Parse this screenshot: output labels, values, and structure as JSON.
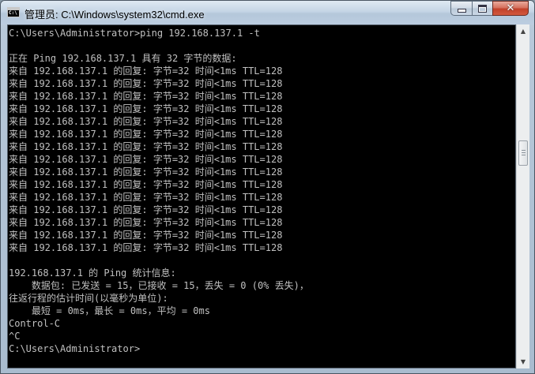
{
  "window": {
    "title": "管理员: C:\\Windows\\system32\\cmd.exe",
    "app_icon_text": "C:\\"
  },
  "controls": {
    "minimize_icon": "minimize-icon",
    "maximize_icon": "maximize-icon",
    "close_icon": "close-icon",
    "close_glyph": "✕"
  },
  "console": {
    "colors": {
      "background": "#000000",
      "text": "#C0C0C0"
    },
    "lines": [
      "C:\\Users\\Administrator>ping 192.168.137.1 -t",
      "",
      "正在 Ping 192.168.137.1 具有 32 字节的数据:",
      "来自 192.168.137.1 的回复: 字节=32 时间<1ms TTL=128",
      "来自 192.168.137.1 的回复: 字节=32 时间<1ms TTL=128",
      "来自 192.168.137.1 的回复: 字节=32 时间<1ms TTL=128",
      "来自 192.168.137.1 的回复: 字节=32 时间<1ms TTL=128",
      "来自 192.168.137.1 的回复: 字节=32 时间<1ms TTL=128",
      "来自 192.168.137.1 的回复: 字节=32 时间<1ms TTL=128",
      "来自 192.168.137.1 的回复: 字节=32 时间<1ms TTL=128",
      "来自 192.168.137.1 的回复: 字节=32 时间<1ms TTL=128",
      "来自 192.168.137.1 的回复: 字节=32 时间<1ms TTL=128",
      "来自 192.168.137.1 的回复: 字节=32 时间<1ms TTL=128",
      "来自 192.168.137.1 的回复: 字节=32 时间<1ms TTL=128",
      "来自 192.168.137.1 的回复: 字节=32 时间<1ms TTL=128",
      "来自 192.168.137.1 的回复: 字节=32 时间<1ms TTL=128",
      "来自 192.168.137.1 的回复: 字节=32 时间<1ms TTL=128",
      "来自 192.168.137.1 的回复: 字节=32 时间<1ms TTL=128",
      "",
      "192.168.137.1 的 Ping 统计信息:",
      "    数据包: 已发送 = 15，已接收 = 15，丢失 = 0 (0% 丢失)，",
      "往返行程的估计时间(以毫秒为单位):",
      "    最短 = 0ms，最长 = 0ms，平均 = 0ms",
      "Control-C",
      "^C",
      "C:\\Users\\Administrator>"
    ]
  },
  "scrollbar": {
    "up_glyph": "▲",
    "down_glyph": "▼",
    "position_fraction": 0.35
  }
}
